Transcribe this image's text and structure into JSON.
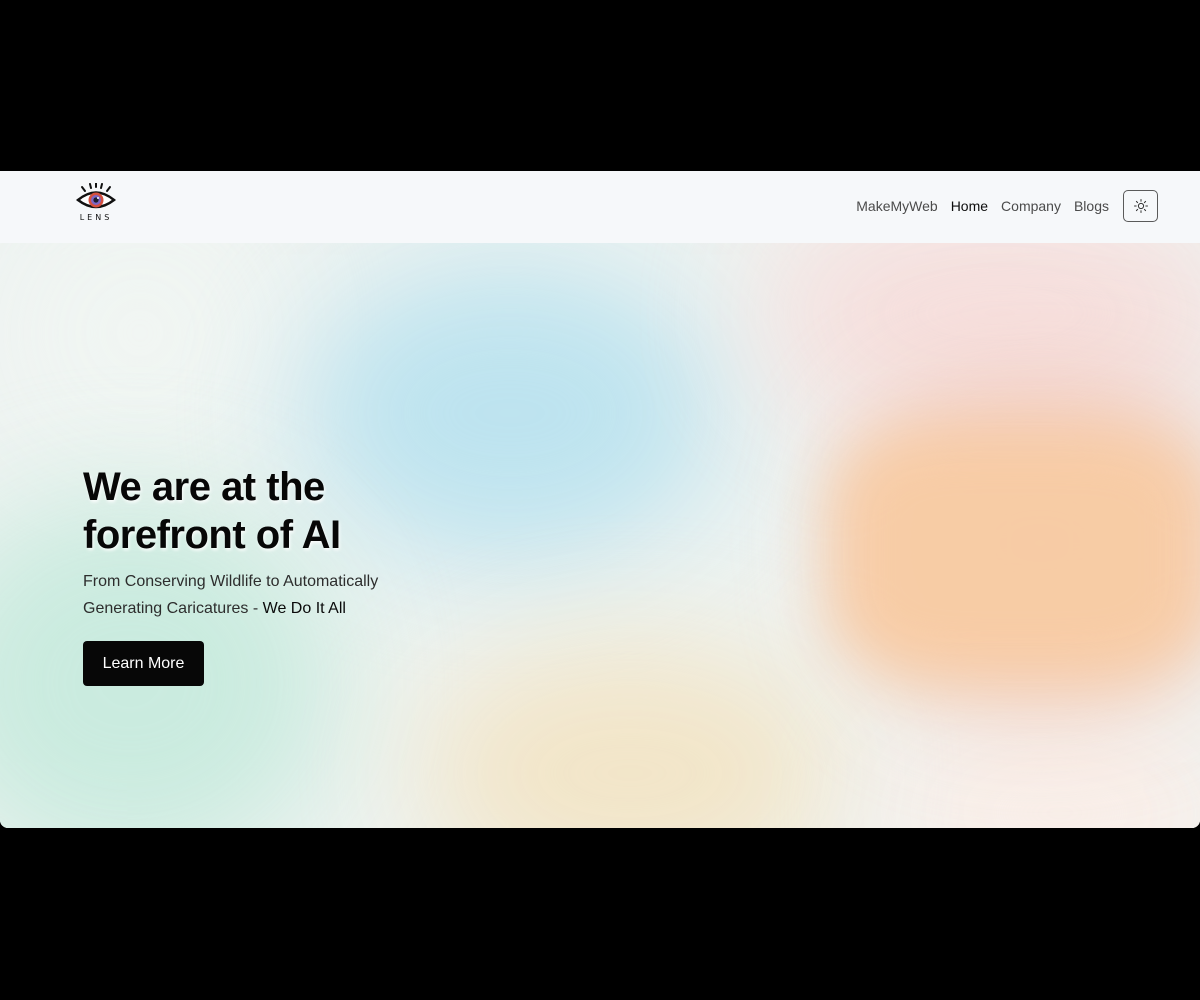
{
  "brand": {
    "logo_text": "LENS",
    "logo_icon": "eye-icon"
  },
  "nav": {
    "items": [
      {
        "label": "MakeMyWeb",
        "active": false
      },
      {
        "label": "Home",
        "active": true
      },
      {
        "label": "Company",
        "active": false
      },
      {
        "label": "Blogs",
        "active": false
      }
    ],
    "theme_toggle_icon": "sun-icon"
  },
  "hero": {
    "headline": "We are at the forefront of AI",
    "subtitle_prefix": "From Conserving Wildlife to Automatically Generating Caricatures - ",
    "subtitle_emphasis": "We Do It All",
    "cta_label": "Learn More"
  },
  "colors": {
    "page_bg": "#000000",
    "navbar_bg": "#f6f8fa",
    "cta_bg": "#070707",
    "cta_text": "#ffffff"
  }
}
